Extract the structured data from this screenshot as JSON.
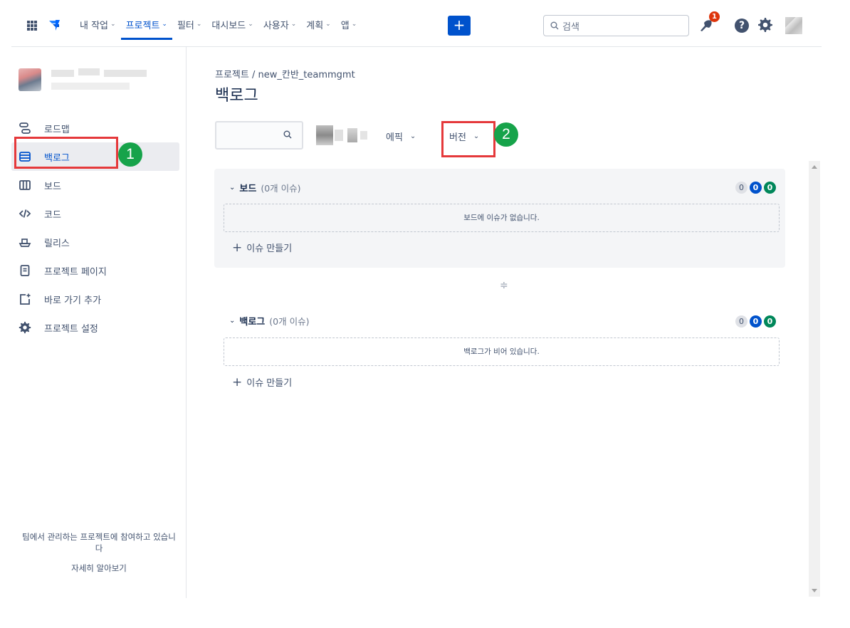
{
  "nav": {
    "items": [
      {
        "label": "내 작업"
      },
      {
        "label": "프로젝트",
        "active": true
      },
      {
        "label": "필터"
      },
      {
        "label": "대시보드"
      },
      {
        "label": "사용자"
      },
      {
        "label": "계획"
      },
      {
        "label": "앱"
      }
    ],
    "create_label": "+",
    "search_placeholder": "검색",
    "notification_count": "1",
    "help_label": "?"
  },
  "sidebar": {
    "items": [
      {
        "label": "로드맵",
        "icon": "roadmap-icon"
      },
      {
        "label": "백로그",
        "icon": "backlog-icon",
        "active": true
      },
      {
        "label": "보드",
        "icon": "board-icon"
      },
      {
        "label": "코드",
        "icon": "code-icon"
      },
      {
        "label": "릴리스",
        "icon": "release-icon"
      },
      {
        "label": "프로젝트 페이지",
        "icon": "page-icon"
      },
      {
        "label": "바로 가기 추가",
        "icon": "add-shortcut-icon"
      },
      {
        "label": "프로젝트 설정",
        "icon": "gear-icon"
      }
    ],
    "footer_text": "팀에서 관리하는 프로젝트에 참여하고 있습니다",
    "learn_more": "자세히 알아보기"
  },
  "main": {
    "breadcrumb": "프로젝트 / new_칸반_teammgmt",
    "title": "백로그",
    "filters": {
      "epic_label": "에픽",
      "version_label": "버전"
    },
    "board_section": {
      "title": "보드",
      "count": "(0개 이슈)",
      "empty_text": "보드에 이슈가 없습니다.",
      "create_label": "이슈 만들기",
      "pills": [
        "0",
        "0",
        "0"
      ]
    },
    "backlog_section": {
      "title": "백로그",
      "count": "(0개 이슈)",
      "empty_text": "백로그가 비어 있습니다.",
      "create_label": "이슈 만들기",
      "pills": [
        "0",
        "0",
        "0"
      ]
    }
  },
  "annotations": {
    "marker1": "1",
    "marker2": "2"
  },
  "colors": {
    "primary": "#0052cc",
    "annotation_red": "#e5393b",
    "annotation_green": "#16a34a",
    "done_green": "#00875a"
  }
}
